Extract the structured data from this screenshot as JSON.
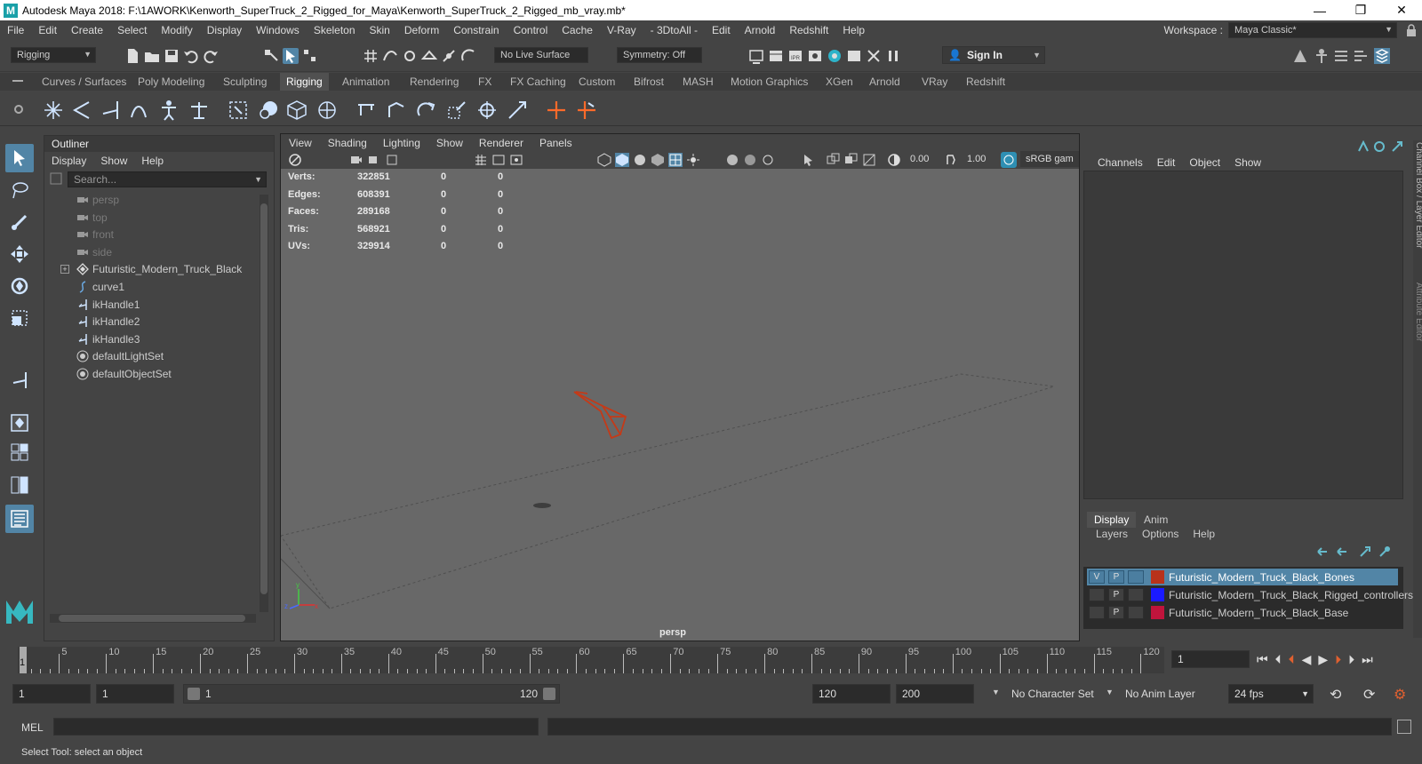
{
  "window": {
    "title": "Autodesk Maya 2018: F:\\1AWORK\\Kenworth_SuperTruck_2_Rigged_for_Maya\\Kenworth_SuperTruck_2_Rigged_mb_vray.mb*",
    "logo": "M"
  },
  "menubar": [
    "File",
    "Edit",
    "Create",
    "Select",
    "Modify",
    "Display",
    "Windows",
    "Skeleton",
    "Skin",
    "Deform",
    "Constrain",
    "Control",
    "Cache",
    "V-Ray",
    "- 3DtoAll -",
    "Edit",
    "Arnold",
    "Redshift",
    "Help"
  ],
  "workspace": {
    "label": "Workspace :",
    "value": "Maya Classic*"
  },
  "statusline": {
    "menuset": "Rigging",
    "live_surface": "No Live Surface",
    "symmetry": "Symmetry: Off",
    "sign_in": "Sign In"
  },
  "shelf_tabs": [
    "Curves / Surfaces",
    "Poly Modeling",
    "Sculpting",
    "Rigging",
    "Animation",
    "Rendering",
    "FX",
    "FX Caching",
    "Custom",
    "Bifrost",
    "MASH",
    "Motion Graphics",
    "XGen",
    "Arnold",
    "VRay",
    "Redshift"
  ],
  "shelf_active": "Rigging",
  "outliner": {
    "title": "Outliner",
    "menu": [
      "Display",
      "Show",
      "Help"
    ],
    "search_placeholder": "Search...",
    "items": [
      {
        "label": "persp",
        "icon": "camera-icon",
        "dim": true
      },
      {
        "label": "top",
        "icon": "camera-icon",
        "dim": true
      },
      {
        "label": "front",
        "icon": "camera-icon",
        "dim": true
      },
      {
        "label": "side",
        "icon": "camera-icon",
        "dim": true
      },
      {
        "label": "Futuristic_Modern_Truck_Black",
        "icon": "group-icon",
        "dim": false,
        "expandable": true
      },
      {
        "label": "curve1",
        "icon": "curve-icon",
        "dim": false
      },
      {
        "label": "ikHandle1",
        "icon": "ik-handle-icon",
        "dim": false
      },
      {
        "label": "ikHandle2",
        "icon": "ik-handle-icon",
        "dim": false
      },
      {
        "label": "ikHandle3",
        "icon": "ik-handle-icon",
        "dim": false
      },
      {
        "label": "defaultLightSet",
        "icon": "set-icon",
        "dim": false
      },
      {
        "label": "defaultObjectSet",
        "icon": "set-icon",
        "dim": false
      }
    ]
  },
  "viewport": {
    "menu": [
      "View",
      "Shading",
      "Lighting",
      "Show",
      "Renderer",
      "Panels"
    ],
    "exposure": "0.00",
    "gamma": "1.00",
    "color_space": "sRGB gam",
    "camera": "persp",
    "hud": [
      {
        "label": "Verts:",
        "v1": "322851",
        "v2": "0",
        "v3": "0"
      },
      {
        "label": "Edges:",
        "v1": "608391",
        "v2": "0",
        "v3": "0"
      },
      {
        "label": "Faces:",
        "v1": "289168",
        "v2": "0",
        "v3": "0"
      },
      {
        "label": "Tris:",
        "v1": "568921",
        "v2": "0",
        "v3": "0"
      },
      {
        "label": "UVs:",
        "v1": "329914",
        "v2": "0",
        "v3": "0"
      }
    ],
    "axis": {
      "x": "x",
      "y": "y",
      "z": "z"
    }
  },
  "channelbox": {
    "menu": [
      "Channels",
      "Edit",
      "Object",
      "Show"
    ]
  },
  "sidetabs": {
    "channel": "Channel Box / Layer Editor",
    "attr": "Attribute Editor"
  },
  "layers": {
    "tabs": [
      "Display",
      "Anim"
    ],
    "menu": [
      "Layers",
      "Options",
      "Help"
    ],
    "rows": [
      {
        "v": "V",
        "p": "P",
        "color": "#b8321b",
        "name": "Futuristic_Modern_Truck_Black_Bones",
        "selected": true
      },
      {
        "v": "",
        "p": "P",
        "color": "#1a1aff",
        "name": "Futuristic_Modern_Truck_Black_Rigged_controllers",
        "selected": false
      },
      {
        "v": "",
        "p": "P",
        "color": "#c0143c",
        "name": "Futuristic_Modern_Truck_Black_Base",
        "selected": false
      }
    ]
  },
  "timeline": {
    "ticks": [
      "5",
      "10",
      "15",
      "20",
      "25",
      "30",
      "35",
      "40",
      "45",
      "50",
      "55",
      "60",
      "65",
      "70",
      "75",
      "80",
      "85",
      "90",
      "95",
      "100",
      "105",
      "110",
      "115",
      "120"
    ],
    "current": "1",
    "current_field": "1"
  },
  "range": {
    "start": "1",
    "playback_start": "1",
    "slider_start": "1",
    "slider_end": "120",
    "playback_end": "120",
    "end": "200",
    "character_set": "No Character Set",
    "anim_layer": "No Anim Layer",
    "fps": "24 fps"
  },
  "cmdline": {
    "label": "MEL"
  },
  "helpline": {
    "text": "Select Tool: select an object"
  },
  "colors": {
    "accent": "#5285a6",
    "bones": "#c43a18"
  }
}
